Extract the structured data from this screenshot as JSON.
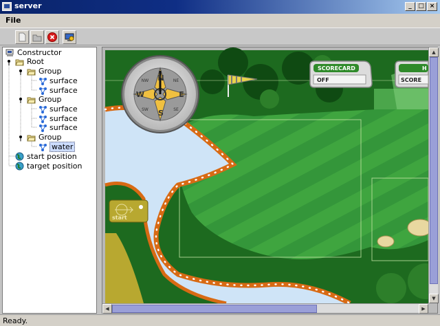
{
  "window": {
    "title": "server"
  },
  "menu": {
    "file": "File"
  },
  "toolbar": {
    "new_icon": "document-icon",
    "open_icon": "folder-icon",
    "stop_icon": "stop-icon",
    "settings_icon": "monitor-icon"
  },
  "tree": {
    "root_label": "Constructor",
    "root_node": "Root",
    "groups": [
      {
        "label": "Group",
        "children": [
          "surface",
          "surface"
        ]
      },
      {
        "label": "Group",
        "children": [
          "surface",
          "surface",
          "surface"
        ]
      },
      {
        "label": "Group",
        "children": [
          "water"
        ]
      }
    ],
    "start": "start position",
    "target": "target position"
  },
  "game": {
    "scorecard_label": "SCORECARD",
    "scorecard_value": "OFF",
    "second_panel_label": "H",
    "second_panel_value": "SCORE",
    "start_label": "start",
    "compass": {
      "n": "N",
      "s": "S",
      "e": "E",
      "w": "W",
      "ne": "NE",
      "nw": "NW",
      "se": "SE",
      "sw": "SW"
    }
  },
  "status": {
    "text": "Ready."
  },
  "colors": {
    "title_blue": "#0a246a",
    "fairway": "#3a9e3a",
    "water": "#cfe4f7",
    "rough": "#1f6b1f",
    "scroll_thumb": "#9a9fd8"
  }
}
